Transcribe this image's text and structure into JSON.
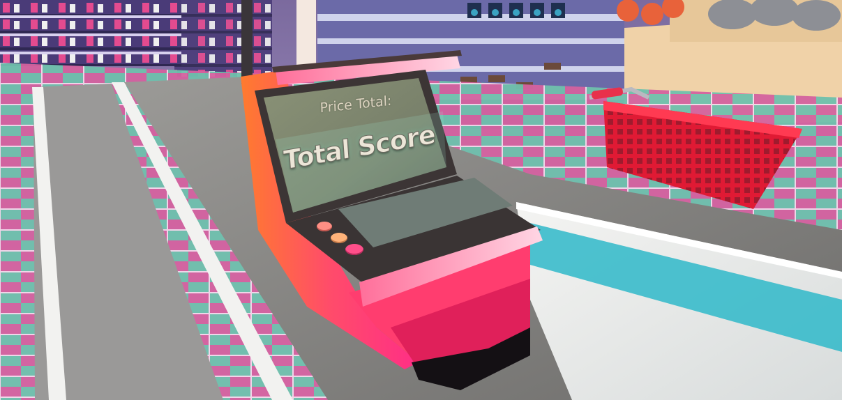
{
  "game": {
    "scene": "supermarket checkout counter",
    "register_screen": {
      "price_label": "Price Total:",
      "score_label": "Total Score"
    },
    "register_buttons": [
      "button-1",
      "button-2",
      "button-3"
    ],
    "colors": {
      "floor_pink": "#e0559a",
      "floor_teal": "#5fb8a8",
      "counter_gray": "#8d8c8a",
      "register_orange": "#f26a3a",
      "register_pink": "#ff3d7f",
      "screen_green": "#7f8a6e",
      "basket_red": "#e0142e",
      "belt_teal": "#2fb9c9"
    }
  }
}
